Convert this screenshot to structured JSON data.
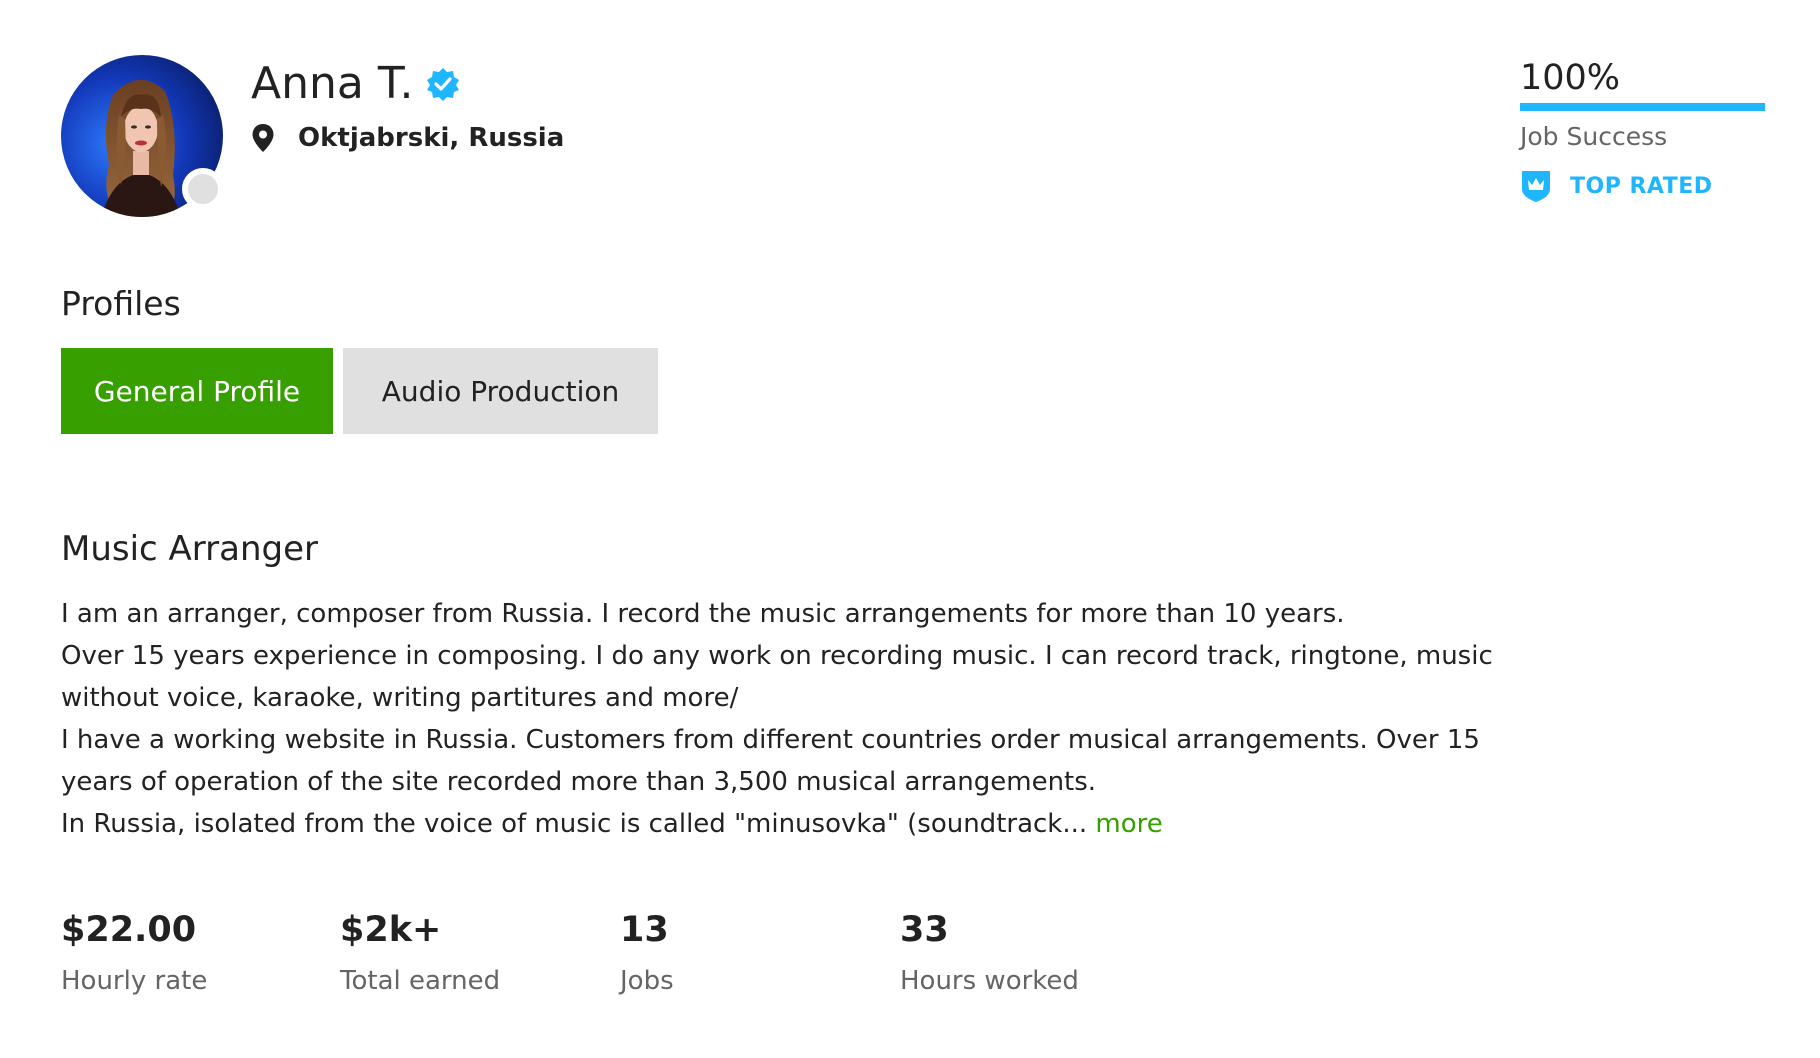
{
  "profile": {
    "name": "Anna T.",
    "location": "Oktjabrski, Russia"
  },
  "job_success": {
    "percent_label": "100%",
    "percent_value": 100,
    "label": "Job Success",
    "badge": "TOP RATED"
  },
  "profiles_section": {
    "heading": "Profiles",
    "tabs": [
      {
        "label": "General Profile",
        "active": true
      },
      {
        "label": "Audio Production",
        "active": false
      }
    ]
  },
  "overview": {
    "title": "Music Arranger",
    "lines": [
      "I am an arranger, composer from Russia. I record the music arrangements for more than 10 years.",
      "Over 15 years experience in composing. I do any work on recording music. I can record track, ringtone, music",
      "without voice, karaoke, writing partitures and more/",
      "I have a working website in Russia. Customers from different countries order musical arrangements. Over 15",
      "years of operation of the site recorded more than 3,500 musical arrangements.",
      "In Russia, isolated from the voice of music is called \"minusovka\" (soundtrack..."
    ],
    "more_label": "more"
  },
  "stats": [
    {
      "value": "$22.00",
      "label": "Hourly rate"
    },
    {
      "value": "$2k+",
      "label": "Total earned"
    },
    {
      "value": "13",
      "label": "Jobs"
    },
    {
      "value": "33",
      "label": "Hours worked"
    }
  ],
  "colors": {
    "accent_green": "#37a000",
    "accent_blue": "#1fb6ff",
    "text_primary": "#222222",
    "text_muted": "#656565",
    "tab_inactive_bg": "#e0e0e0"
  },
  "icons": {
    "verified": "verified-badge-icon",
    "location": "map-pin-icon",
    "top_rated": "crown-shield-icon",
    "status": "offline-status-dot"
  }
}
